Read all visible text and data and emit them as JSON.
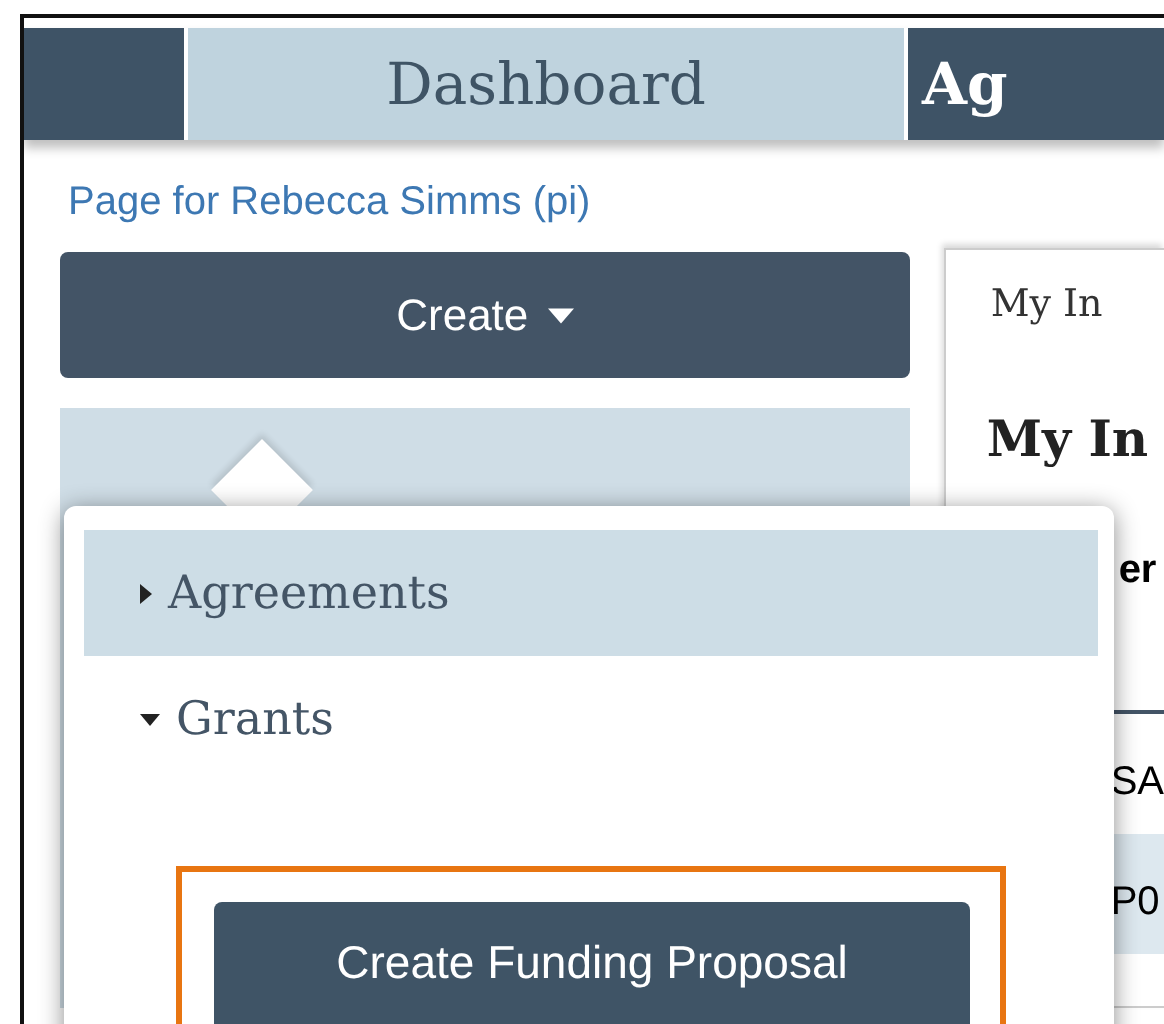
{
  "nav_tabs": [
    {
      "selected": false
    },
    {
      "label": "Dashboard",
      "selected": true
    },
    {
      "label": "Ag",
      "selected": false
    }
  ],
  "page_link": "Page for Rebecca Simms (pi)",
  "create_button": {
    "label": "Create"
  },
  "menu": {
    "groups": [
      {
        "label": "Agreements",
        "expanded": false,
        "selected": true
      },
      {
        "label": "Grants",
        "expanded": true,
        "selected": false,
        "children": [
          {
            "label": "Create Funding Proposal",
            "highlighted": true
          }
        ]
      }
    ]
  },
  "side_panel": {
    "tab": "My In",
    "heading": "My In",
    "column_header": "er",
    "rows": [
      {
        "cell": "SA",
        "selected": false
      },
      {
        "cell": "P0",
        "selected": true
      }
    ]
  }
}
